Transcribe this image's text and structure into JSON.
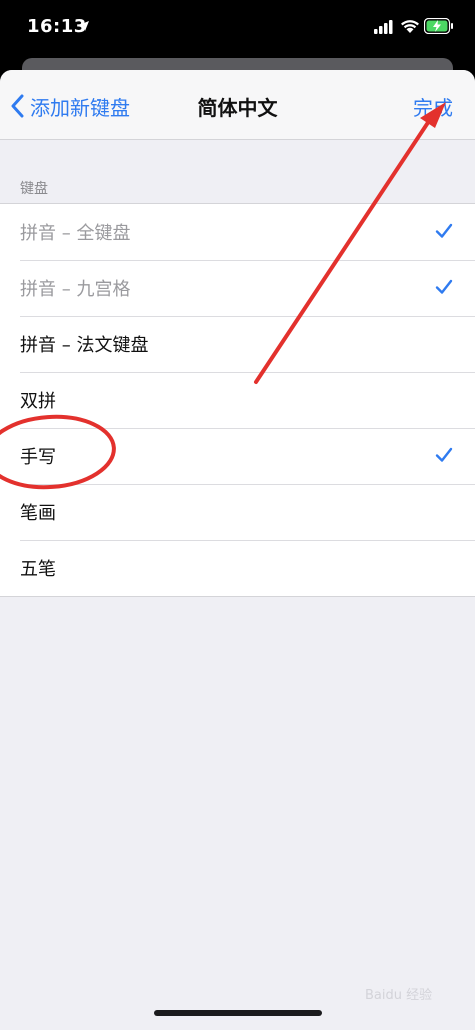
{
  "status_bar": {
    "time": "16:13"
  },
  "nav": {
    "back_label": "添加新键盘",
    "title": "简体中文",
    "done_label": "完成"
  },
  "section": {
    "header": "键盘"
  },
  "keyboards": [
    {
      "label": "拼音 – 全键盘",
      "checked": true,
      "disabled": true
    },
    {
      "label": "拼音 – 九宫格",
      "checked": true,
      "disabled": true
    },
    {
      "label": "拼音 – 法文键盘",
      "checked": false,
      "disabled": false
    },
    {
      "label": "双拼",
      "checked": false,
      "disabled": false
    },
    {
      "label": "手写",
      "checked": true,
      "disabled": false
    },
    {
      "label": "笔画",
      "checked": false,
      "disabled": false
    },
    {
      "label": "五笔",
      "checked": false,
      "disabled": false
    }
  ],
  "colors": {
    "accent": "#2f7bf0",
    "annotation": "#e3312d"
  },
  "watermark": "Baidu 经验"
}
